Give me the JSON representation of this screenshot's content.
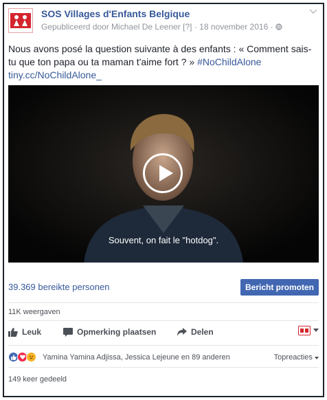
{
  "page": {
    "name": "SOS Villages d'Enfants Belgique",
    "published_by": "Gepubliceerd door Michael De Leener",
    "help_marker": "[?]",
    "separator": "·",
    "date": "18 november 2016",
    "privacy_icon": "globe-icon",
    "menu_icon": "chevron-down-icon"
  },
  "post": {
    "text_part1": "Nous avons posé la question suivante à des enfants : « Comment sais-tu que ton papa ou ta maman t'aime fort ? » ",
    "hashtag": "#NoChildAlone",
    "link": "tiny.cc/NoChildAlone_"
  },
  "video": {
    "subtitle": "Souvent, on fait le \"hotdog\".",
    "play_icon": "play-icon"
  },
  "stats": {
    "reach": "39.369 bereikte personen",
    "promote_label": "Bericht promoten",
    "views": "11K weergaven"
  },
  "actions": {
    "like": "Leuk",
    "comment": "Opmerking plaatsen",
    "share": "Delen"
  },
  "reactions": {
    "icons": [
      "like",
      "love",
      "sad"
    ],
    "names": "Yamina Yamina Adjissa, Jessica Lejeune en 89 anderen",
    "sort": "Topreacties"
  },
  "shares": {
    "text": "149 keer gedeeld"
  },
  "colors": {
    "link": "#365899",
    "button": "#4267b2",
    "logo": "#d4252e"
  }
}
